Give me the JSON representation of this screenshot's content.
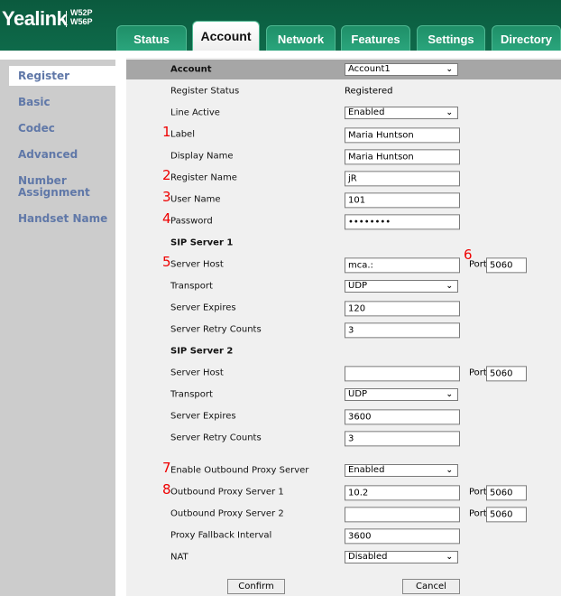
{
  "brand": {
    "logo": "Yealink",
    "models": [
      "W52P",
      "W56P"
    ]
  },
  "tabs": [
    {
      "label": "Status"
    },
    {
      "label": "Account",
      "active": true
    },
    {
      "label": "Network"
    },
    {
      "label": "Features"
    },
    {
      "label": "Settings"
    },
    {
      "label": "Directory"
    }
  ],
  "sidebar": {
    "items": [
      {
        "label": "Register",
        "active": true
      },
      {
        "label": "Basic"
      },
      {
        "label": "Codec"
      },
      {
        "label": "Advanced"
      },
      {
        "label": "Number Assignment"
      },
      {
        "label": "Handset Name"
      }
    ]
  },
  "form": {
    "rows": [
      {
        "label": "Account",
        "type": "select",
        "value": "Account1",
        "bold": true
      },
      {
        "label": "Register Status",
        "type": "text",
        "value": "Registered"
      },
      {
        "label": "Line Active",
        "type": "select",
        "value": "Enabled"
      },
      {
        "label": "Label",
        "type": "input",
        "value": "Maria Huntson",
        "marker": "1"
      },
      {
        "label": "Display Name",
        "type": "input",
        "value": "Maria Huntson"
      },
      {
        "label": "Register Name",
        "type": "input",
        "value": "jR",
        "marker": "2"
      },
      {
        "label": "User Name",
        "type": "input",
        "value": "101",
        "marker": "3"
      },
      {
        "label": "Password",
        "type": "input",
        "value": "••••••••",
        "marker": "4"
      },
      {
        "label": "SIP Server 1",
        "type": "heading"
      },
      {
        "label": "Server Host",
        "type": "input",
        "value": "mca.:",
        "marker": "5",
        "port": "5060",
        "port_label": "Port",
        "port_marker": "6"
      },
      {
        "label": "Transport",
        "type": "select",
        "value": "UDP"
      },
      {
        "label": "Server Expires",
        "type": "input",
        "value": "120"
      },
      {
        "label": "Server Retry Counts",
        "type": "input",
        "value": "3"
      },
      {
        "label": "SIP Server 2",
        "type": "heading"
      },
      {
        "label": "Server Host",
        "type": "input",
        "value": "",
        "port": "5060",
        "port_label": "Port"
      },
      {
        "label": "Transport",
        "type": "select",
        "value": "UDP"
      },
      {
        "label": "Server Expires",
        "type": "input",
        "value": "3600"
      },
      {
        "label": "Server Retry Counts",
        "type": "input",
        "value": "3"
      },
      {
        "label": "Enable Outbound Proxy Server",
        "type": "select",
        "value": "Enabled",
        "marker": "7"
      },
      {
        "label": "Outbound Proxy Server 1",
        "type": "input",
        "value": "10.2",
        "marker": "8",
        "port": "5060",
        "port_label": "Port"
      },
      {
        "label": "Outbound Proxy Server 2",
        "type": "input",
        "value": "",
        "port": "5060",
        "port_label": "Port"
      },
      {
        "label": "Proxy Fallback Interval",
        "type": "input",
        "value": "3600"
      },
      {
        "label": "NAT",
        "type": "select",
        "value": "Disabled"
      }
    ],
    "confirm_label": "Confirm",
    "cancel_label": "Cancel"
  }
}
